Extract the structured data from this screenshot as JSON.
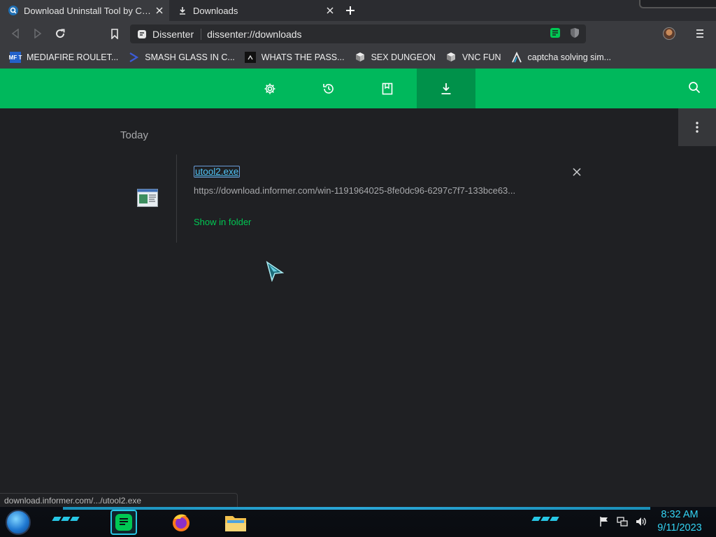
{
  "tabs": [
    {
      "title": "Download Uninstall Tool by Crysta",
      "icon": "search-tab-icon",
      "active": true
    },
    {
      "title": "Downloads",
      "icon": "download-tab-icon",
      "active": false
    }
  ],
  "toolbar": {
    "site_name": "Dissenter",
    "url": "dissenter://downloads"
  },
  "bookmarks": [
    {
      "label": "MEDIAFIRE ROULET...",
      "icon": "mft-icon",
      "icon_text": "MF T"
    },
    {
      "label": "SMASH GLASS IN C...",
      "icon": "chevron-bookmark-icon"
    },
    {
      "label": "WHATS THE PASS...",
      "icon": "terminal-bookmark-icon"
    },
    {
      "label": "SEX DUNGEON",
      "icon": "vnc-bookmark-icon"
    },
    {
      "label": "VNC FUN",
      "icon": "vnc-bookmark-icon"
    },
    {
      "label": "captcha solving sim...",
      "icon": "lambda-bookmark-icon"
    }
  ],
  "header": {
    "tabs": [
      "settings-icon",
      "history-icon",
      "bookmarks-icon",
      "downloads-icon"
    ],
    "active": "downloads-icon"
  },
  "downloads": {
    "section": "Today",
    "items": [
      {
        "filename": "utool2.exe",
        "url": "https://download.informer.com/win-1191964025-8fe0dc96-6297c7f7-133bce63...",
        "action": "Show in folder"
      }
    ]
  },
  "statusbar": "download.informer.com/.../utool2.exe",
  "taskbar": {
    "time": "8:32 AM",
    "date": "9/11/2023"
  },
  "colors": {
    "accent": "#00b85c",
    "accent_dark": "#00914a",
    "link": "#4fc3f7",
    "clock": "#33d4f4"
  }
}
